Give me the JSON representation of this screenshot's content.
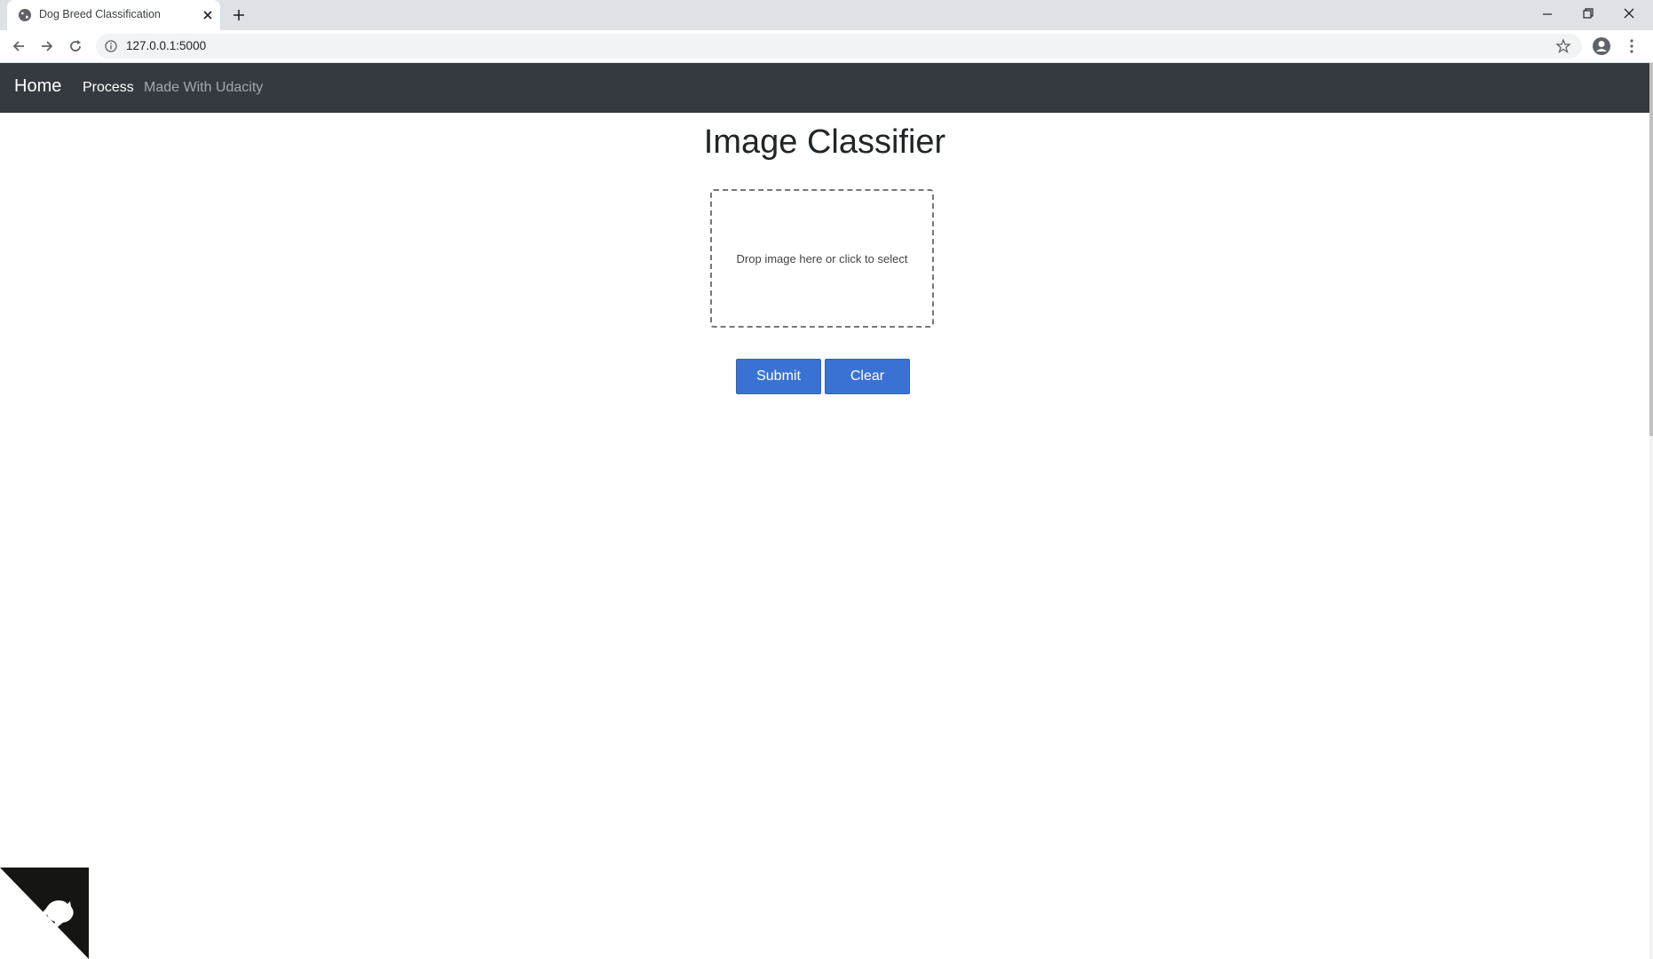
{
  "browser": {
    "tab_title": "Dog Breed Classification",
    "url": "127.0.0.1:5000"
  },
  "navbar": {
    "brand": "Home",
    "links": [
      "Process",
      "Made With Udacity"
    ]
  },
  "main": {
    "title": "Image Classifier",
    "dropzone_text": "Drop image here or click to select",
    "submit_label": "Submit",
    "clear_label": "Clear"
  },
  "colors": {
    "navbar_bg": "#343a40",
    "button_bg": "#3a72d4",
    "chrome_bg": "#dee1e6"
  },
  "icons": [
    "globe-icon",
    "close-icon",
    "plus-icon",
    "minimize-icon",
    "restore-icon",
    "back-icon",
    "forward-icon",
    "reload-icon",
    "info-icon",
    "star-icon",
    "profile-icon",
    "menu-icon",
    "github-octocat-icon"
  ]
}
